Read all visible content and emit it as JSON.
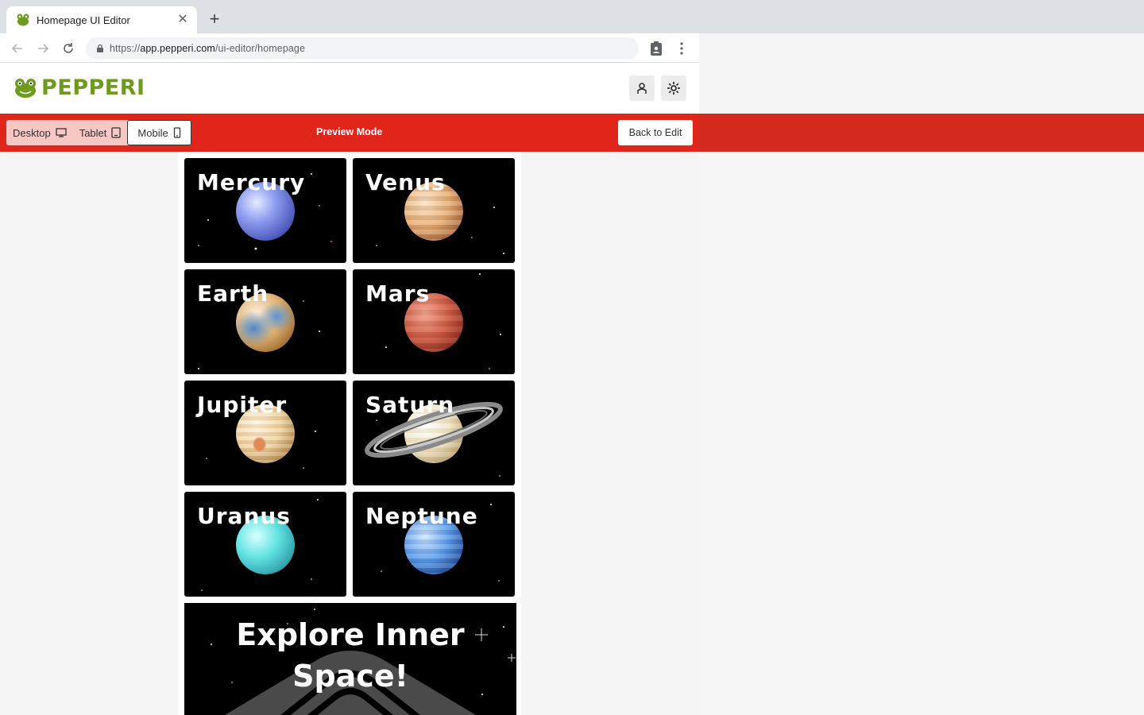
{
  "browser": {
    "tab_title": "Homepage UI Editor",
    "url_host": "app.pepperi.com",
    "url_prefix": "https://",
    "url_path": "/ui-editor/homepage"
  },
  "header": {
    "logo_text": "PEPPERI"
  },
  "preview_bar": {
    "modes": [
      "Desktop",
      "Tablet",
      "Mobile"
    ],
    "active_mode": "Mobile",
    "label": "Preview Mode",
    "back_label": "Back to Edit"
  },
  "planets": [
    {
      "name": "Mercury",
      "color": "#7f8fe0"
    },
    {
      "name": "Venus",
      "color": "#e0a770"
    },
    {
      "name": "Earth",
      "color": "#d9b070"
    },
    {
      "name": "Mars",
      "color": "#c9523e"
    },
    {
      "name": "Jupiter",
      "color": "#efd6a6"
    },
    {
      "name": "Saturn",
      "color": "#f2e6c8"
    },
    {
      "name": "Uranus",
      "color": "#5fe0e0"
    },
    {
      "name": "Neptune",
      "color": "#4a8ee0"
    }
  ],
  "banner": {
    "line1": "Explore Inner",
    "line2": "Space!"
  },
  "colors": {
    "accent_red": "#e0251a",
    "logo_green": "#6e9b1c"
  }
}
